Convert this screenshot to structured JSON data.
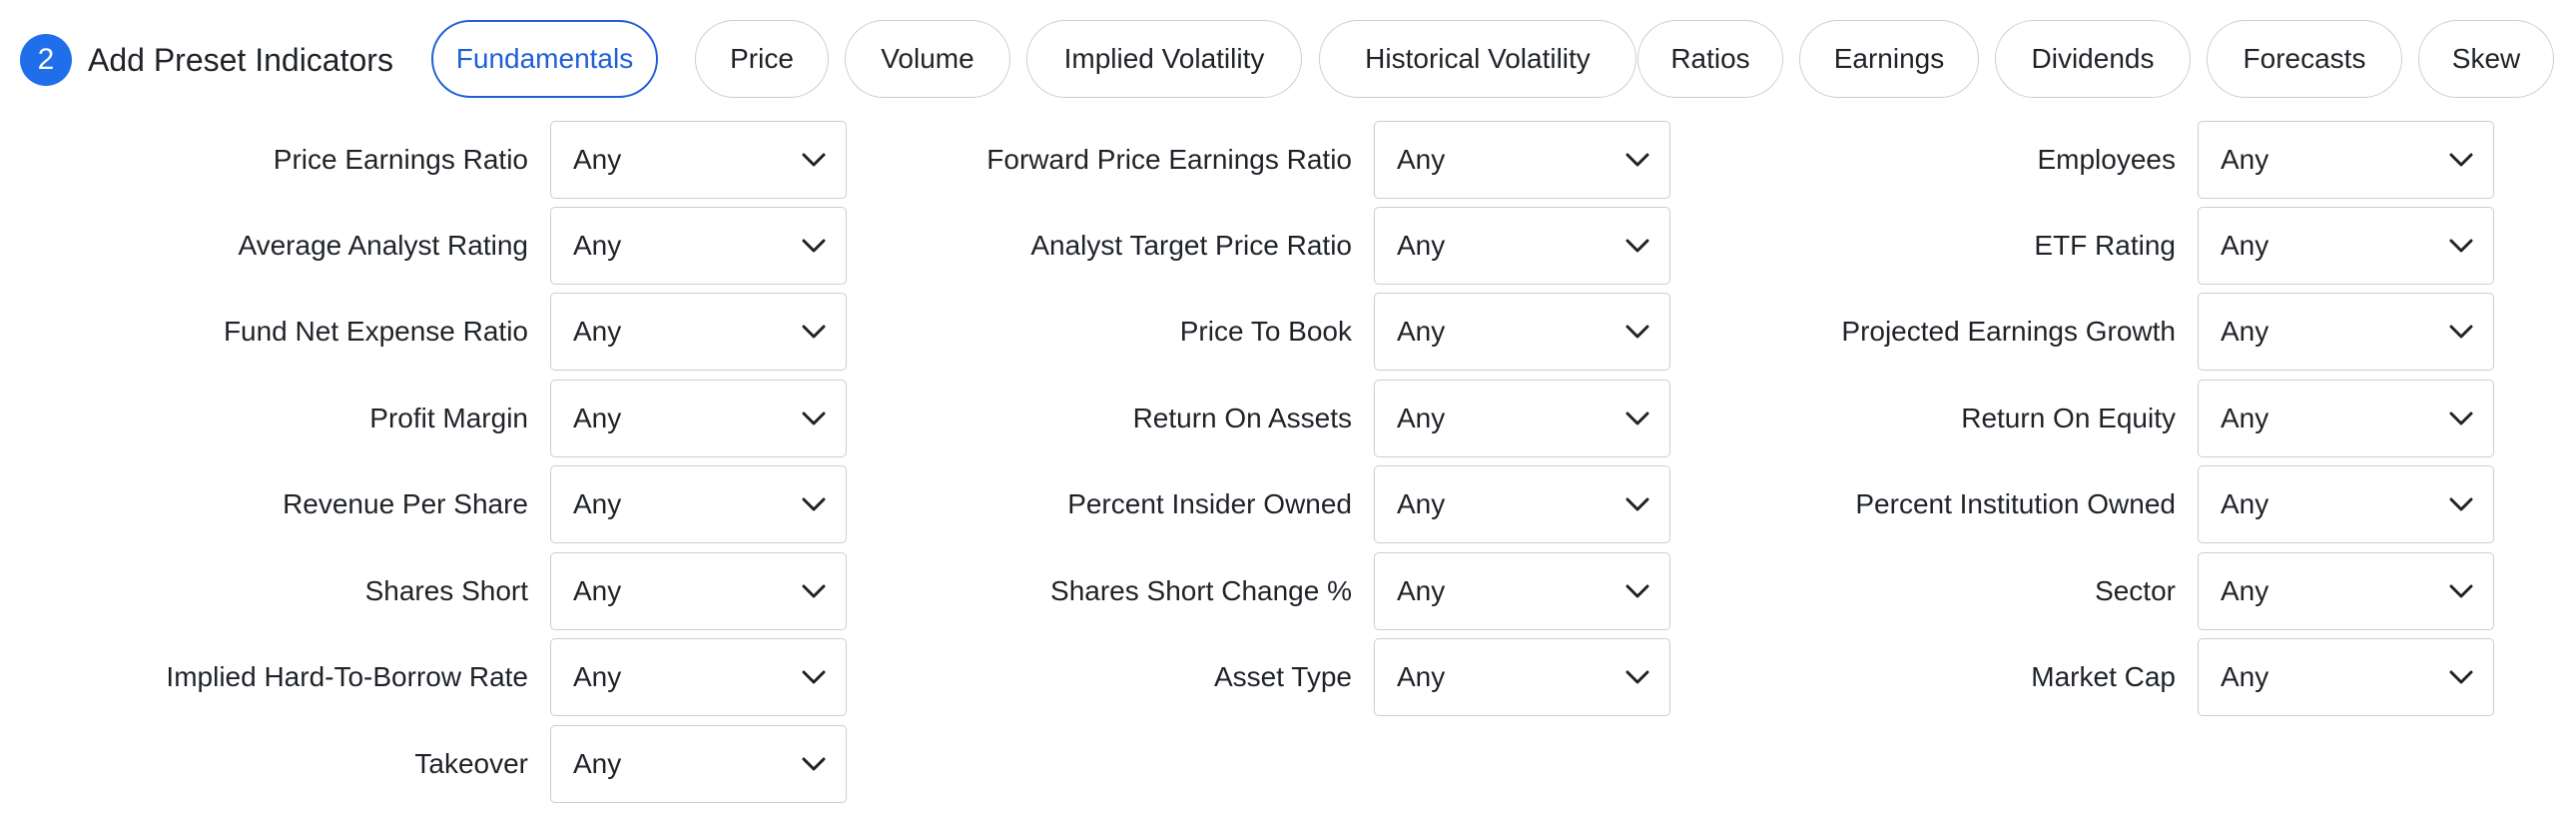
{
  "header": {
    "step_number": "2",
    "title": "Add Preset Indicators"
  },
  "tabs": [
    {
      "label": "Fundamentals",
      "active": true
    },
    {
      "label": "Price",
      "active": false
    },
    {
      "label": "Volume",
      "active": false
    },
    {
      "label": "Implied Volatility",
      "active": false
    },
    {
      "label": "Historical Volatility",
      "active": false
    },
    {
      "label": "Ratios",
      "active": false
    },
    {
      "label": "Earnings",
      "active": false
    },
    {
      "label": "Dividends",
      "active": false
    },
    {
      "label": "Forecasts",
      "active": false
    },
    {
      "label": "Skew",
      "active": false
    }
  ],
  "fields": [
    {
      "label": "Price Earnings Ratio",
      "value": "Any"
    },
    {
      "label": "Forward Price Earnings Ratio",
      "value": "Any"
    },
    {
      "label": "Employees",
      "value": "Any"
    },
    {
      "label": "Average Analyst Rating",
      "value": "Any"
    },
    {
      "label": "Analyst Target Price Ratio",
      "value": "Any"
    },
    {
      "label": "ETF Rating",
      "value": "Any"
    },
    {
      "label": "Fund Net Expense Ratio",
      "value": "Any"
    },
    {
      "label": "Price To Book",
      "value": "Any"
    },
    {
      "label": "Projected Earnings Growth",
      "value": "Any"
    },
    {
      "label": "Profit Margin",
      "value": "Any"
    },
    {
      "label": "Return On Assets",
      "value": "Any"
    },
    {
      "label": "Return On Equity",
      "value": "Any"
    },
    {
      "label": "Revenue Per Share",
      "value": "Any"
    },
    {
      "label": "Percent Insider Owned",
      "value": "Any"
    },
    {
      "label": "Percent Institution Owned",
      "value": "Any"
    },
    {
      "label": "Shares Short",
      "value": "Any"
    },
    {
      "label": "Shares Short Change %",
      "value": "Any"
    },
    {
      "label": "Sector",
      "value": "Any"
    },
    {
      "label": "Implied Hard-To-Borrow Rate",
      "value": "Any"
    },
    {
      "label": "Asset Type",
      "value": "Any"
    },
    {
      "label": "Market Cap",
      "value": "Any"
    },
    {
      "label": "Takeover",
      "value": "Any"
    }
  ],
  "colors": {
    "accent": "#1f5fd6",
    "badge": "#1f6feb",
    "border": "#c9ced6",
    "text": "#1f2328"
  },
  "icons": {
    "select_arrow": "chevron-down-icon"
  }
}
